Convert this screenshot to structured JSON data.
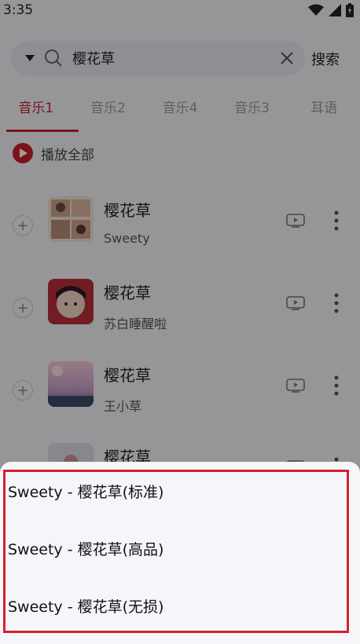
{
  "status_bar": {
    "time": "3:35"
  },
  "search": {
    "query": "樱花草",
    "button_label": "搜索"
  },
  "tabs": [
    {
      "label": "音乐1",
      "active": true
    },
    {
      "label": "音乐2",
      "active": false
    },
    {
      "label": "音乐4",
      "active": false
    },
    {
      "label": "音乐3",
      "active": false
    },
    {
      "label": "耳语",
      "active": false
    }
  ],
  "play_all": {
    "label": "播放全部"
  },
  "songs": [
    {
      "title": "樱花草",
      "artist": "Sweety"
    },
    {
      "title": "樱花草",
      "artist": "苏白睡醒啦"
    },
    {
      "title": "樱花草",
      "artist": "王小草"
    },
    {
      "title": "樱花草",
      "artist": ""
    }
  ],
  "quality_sheet": {
    "options": [
      "Sweety - 樱花草(标准)",
      "Sweety - 樱花草(高品)",
      "Sweety - 樱花草(无损)"
    ]
  },
  "colors": {
    "accent": "#c8202a",
    "highlight_frame": "#d6202a",
    "sheet_bg": "#f5f6fa"
  }
}
